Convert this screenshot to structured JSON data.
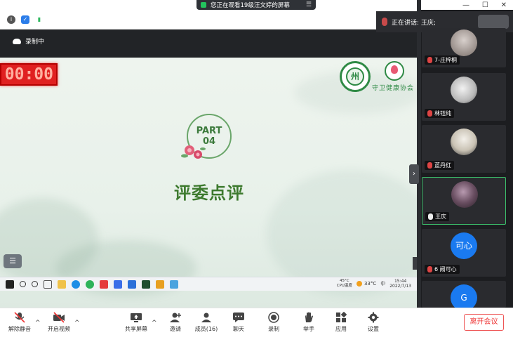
{
  "top_banner": {
    "text": "您正在观看19级汪文婷的屏幕",
    "menu_icon": "list-icon"
  },
  "window_controls": {
    "minimize": "—",
    "restore": "☐",
    "close": "✕"
  },
  "recording": {
    "label": "录制中"
  },
  "speaking": {
    "label": "正在讲话: 王庆;"
  },
  "slide": {
    "timer": "00:00",
    "part_label": "PART",
    "part_number": "04",
    "title": "评委点评",
    "org_name": "守卫健康协会",
    "left_logo_text": "州"
  },
  "remote_taskbar": {
    "cpu_temp": "45°C",
    "cpu_label": "CPU温度",
    "weather": "33°C",
    "ime_lang": "中",
    "time": "15:44",
    "date": "2022/7/13"
  },
  "participants": [
    {
      "name": "7-庄梓桐",
      "muted": true
    },
    {
      "name": "林钰纯",
      "muted": true
    },
    {
      "name": "蓝丹红",
      "muted": true
    },
    {
      "name": "王庆",
      "muted": false,
      "active": true
    },
    {
      "name": "6 阙可心",
      "muted": true,
      "avatar_text": "可心"
    },
    {
      "name": "",
      "muted": true,
      "avatar_text": "G"
    }
  ],
  "toolbar": {
    "unmute": "解除静音",
    "start_video": "开启视频",
    "share_screen": "共享屏幕",
    "invite": "邀请",
    "members": "成员(16)",
    "chat": "聊天",
    "record": "录制",
    "raise_hand": "举手",
    "apps": "应用",
    "settings": "设置",
    "leave": "离开会议"
  },
  "colors": {
    "accent_green": "#3d7a2e",
    "timer_red": "#e02020",
    "leave_red": "#e33333",
    "active_border": "#3bbf6a"
  }
}
